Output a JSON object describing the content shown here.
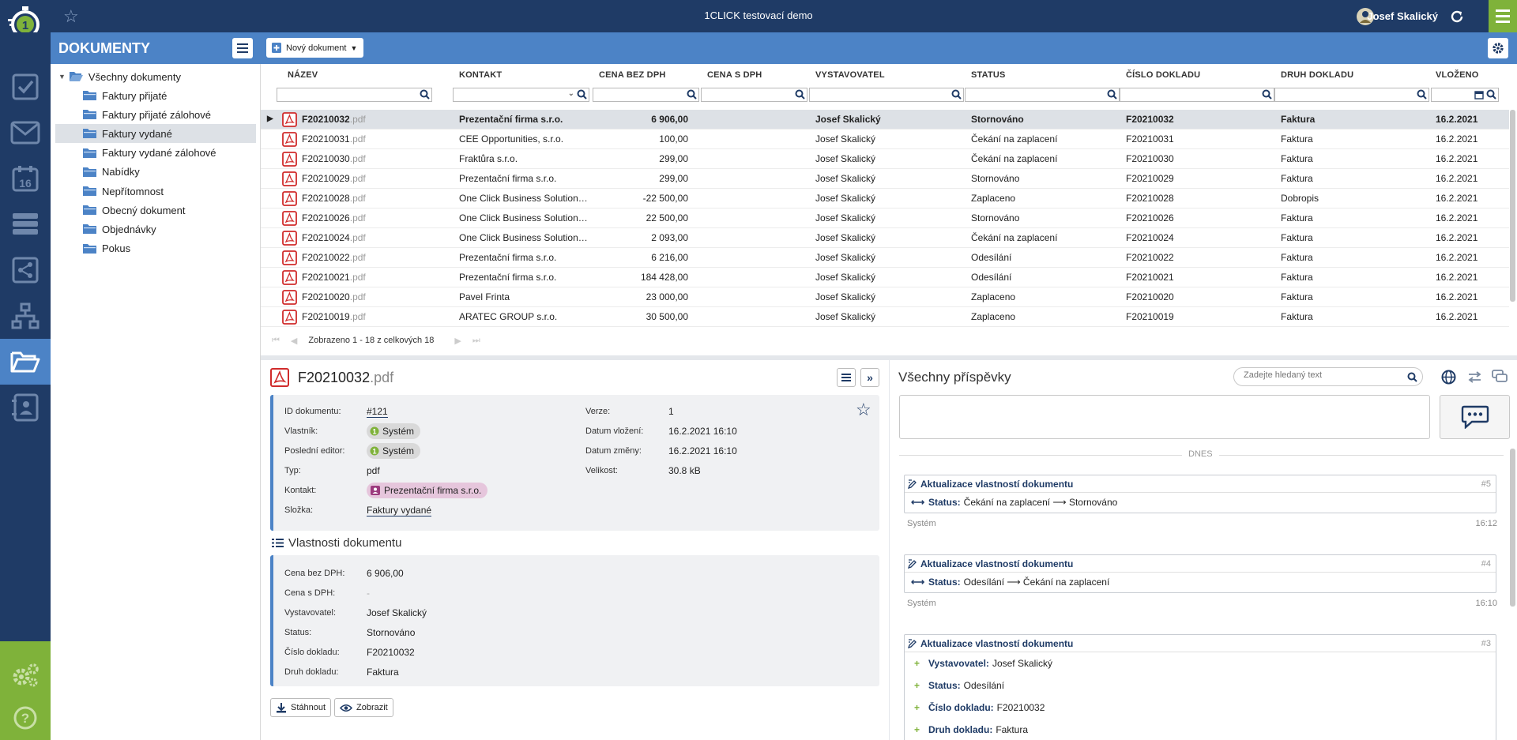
{
  "app": {
    "title": "1CLICK testovací demo",
    "user": "Josef Skalický"
  },
  "section": {
    "title": "DOKUMENTY",
    "new_doc_label": "Nový dokument"
  },
  "tree": {
    "root": "Všechny dokumenty",
    "items": [
      "Faktury přijaté",
      "Faktury přijaté zálohové",
      "Faktury vydané",
      "Faktury vydané zálohové",
      "Nabídky",
      "Nepřítomnost",
      "Obecný dokument",
      "Objednávky",
      "Pokus"
    ],
    "selected": "Faktury vydané"
  },
  "grid": {
    "columns": [
      "NÁZEV",
      "KONTAKT",
      "CENA BEZ DPH",
      "CENA S DPH",
      "VYSTAVOVATEL",
      "STATUS",
      "ČÍSLO DOKLADU",
      "DRUH DOKLADU",
      "VLOŽENO"
    ],
    "rows": [
      {
        "name": "F20210032",
        "ext": ".pdf",
        "contact": "Prezentační firma s.r.o.",
        "price": "6 906,00",
        "price_vat": "",
        "issuer": "Josef Skalický",
        "status": "Stornováno",
        "number": "F20210032",
        "kind": "Faktura",
        "date": "16.2.2021"
      },
      {
        "name": "F20210031",
        "ext": ".pdf",
        "contact": "CEE Opportunities, s.r.o.",
        "price": "100,00",
        "price_vat": "",
        "issuer": "Josef Skalický",
        "status": "Čekání na zaplacení",
        "number": "F20210031",
        "kind": "Faktura",
        "date": "16.2.2021"
      },
      {
        "name": "F20210030",
        "ext": ".pdf",
        "contact": "Fraktůra s.r.o.",
        "price": "299,00",
        "price_vat": "",
        "issuer": "Josef Skalický",
        "status": "Čekání na zaplacení",
        "number": "F20210030",
        "kind": "Faktura",
        "date": "16.2.2021"
      },
      {
        "name": "F20210029",
        "ext": ".pdf",
        "contact": "Prezentační firma s.r.o.",
        "price": "299,00",
        "price_vat": "",
        "issuer": "Josef Skalický",
        "status": "Stornováno",
        "number": "F20210029",
        "kind": "Faktura",
        "date": "16.2.2021"
      },
      {
        "name": "F20210028",
        "ext": ".pdf",
        "contact": "One Click Business Solutions...",
        "price": "-22 500,00",
        "price_vat": "",
        "issuer": "Josef Skalický",
        "status": "Zaplaceno",
        "number": "F20210028",
        "kind": "Dobropis",
        "date": "16.2.2021"
      },
      {
        "name": "F20210026",
        "ext": ".pdf",
        "contact": "One Click Business Solutions...",
        "price": "22 500,00",
        "price_vat": "",
        "issuer": "Josef Skalický",
        "status": "Stornováno",
        "number": "F20210026",
        "kind": "Faktura",
        "date": "16.2.2021"
      },
      {
        "name": "F20210024",
        "ext": ".pdf",
        "contact": "One Click Business Solutions...",
        "price": "2 093,00",
        "price_vat": "",
        "issuer": "Josef Skalický",
        "status": "Čekání na zaplacení",
        "number": "F20210024",
        "kind": "Faktura",
        "date": "16.2.2021"
      },
      {
        "name": "F20210022",
        "ext": ".pdf",
        "contact": "Prezentační firma s.r.o.",
        "price": "6 216,00",
        "price_vat": "",
        "issuer": "Josef Skalický",
        "status": "Odesílání",
        "number": "F20210022",
        "kind": "Faktura",
        "date": "16.2.2021"
      },
      {
        "name": "F20210021",
        "ext": ".pdf",
        "contact": "Prezentační firma s.r.o.",
        "price": "184 428,00",
        "price_vat": "",
        "issuer": "Josef Skalický",
        "status": "Odesílání",
        "number": "F20210021",
        "kind": "Faktura",
        "date": "16.2.2021"
      },
      {
        "name": "F20210020",
        "ext": ".pdf",
        "contact": "Pavel Frinta",
        "price": "23 000,00",
        "price_vat": "",
        "issuer": "Josef Skalický",
        "status": "Zaplaceno",
        "number": "F20210020",
        "kind": "Faktura",
        "date": "16.2.2021"
      },
      {
        "name": "F20210019",
        "ext": ".pdf",
        "contact": "ARATEC GROUP s.r.o.",
        "price": "30 500,00",
        "price_vat": "",
        "issuer": "Josef Skalický",
        "status": "Zaplaceno",
        "number": "F20210019",
        "kind": "Faktura",
        "date": "16.2.2021"
      }
    ],
    "pager": "Zobrazeno 1 - 18 z celkových 18"
  },
  "detail": {
    "file": "F20210032",
    "ext": ".pdf",
    "left_fields": [
      {
        "label": "ID dokumentu:",
        "value": "#121"
      },
      {
        "label": "Vlastník:",
        "value": "Systém"
      },
      {
        "label": "Poslední editor:",
        "value": "Systém"
      },
      {
        "label": "Typ:",
        "value": "pdf"
      },
      {
        "label": "Kontakt:",
        "value": "Prezentační firma s.r.o."
      },
      {
        "label": "Složka:",
        "value": "Faktury vydané"
      }
    ],
    "right_fields": [
      {
        "label": "Verze:",
        "value": "1"
      },
      {
        "label": "Datum vložení:",
        "value": "16.2.2021 16:10"
      },
      {
        "label": "Datum změny:",
        "value": "16.2.2021 16:10"
      },
      {
        "label": "Velikost:",
        "value": "30.8 kB"
      }
    ],
    "props_title": "Vlastnosti dokumentu",
    "props": [
      {
        "label": "Cena bez DPH:",
        "value": "6 906,00"
      },
      {
        "label": "Cena s DPH:",
        "value": "-"
      },
      {
        "label": "Vystavovatel:",
        "value": "Josef Skalický"
      },
      {
        "label": "Status:",
        "value": "Stornováno"
      },
      {
        "label": "Číslo dokladu:",
        "value": "F20210032"
      },
      {
        "label": "Druh dokladu:",
        "value": "Faktura"
      }
    ],
    "download_label": "Stáhnout",
    "view_label": "Zobrazit"
  },
  "comments": {
    "title": "Všechny příspěvky",
    "search_placeholder": "Zadejte hledaný text",
    "day": "DNES",
    "events": [
      {
        "title": "Aktualizace vlastností dokumentu",
        "num": "#5",
        "rows": [
          {
            "k": "Status:",
            "v": "Čekání na zaplacení ⟶ Stornováno"
          }
        ],
        "author": "Systém",
        "time": "16:12"
      },
      {
        "title": "Aktualizace vlastností dokumentu",
        "num": "#4",
        "rows": [
          {
            "k": "Status:",
            "v": "Odesílání ⟶ Čekání na zaplacení"
          }
        ],
        "author": "Systém",
        "time": "16:10"
      },
      {
        "title": "Aktualizace vlastností dokumentu",
        "num": "#3",
        "rows": [
          {
            "k": "Vystavovatel:",
            "v": "Josef Skalický"
          },
          {
            "k": "Status:",
            "v": "Odesílání"
          },
          {
            "k": "Číslo dokladu:",
            "v": "F20210032"
          },
          {
            "k": "Druh dokladu:",
            "v": "Faktura"
          }
        ]
      }
    ]
  },
  "colors": {
    "navy": "#1f3b66",
    "blue": "#4c83c6",
    "green": "#7fb23a",
    "pdf_red": "#d02b2b"
  },
  "icons": [
    "star-icon",
    "refresh-icon",
    "menu-icon",
    "checklist-icon",
    "mail-icon",
    "calendar-icon",
    "list-icon",
    "share-icon",
    "org-chart-icon",
    "folder-open-icon",
    "contacts-icon",
    "gears-icon",
    "help-icon",
    "pdf-icon",
    "search-icon",
    "calendar-icon",
    "globe-icon",
    "swap-icon",
    "chat-icon"
  ]
}
